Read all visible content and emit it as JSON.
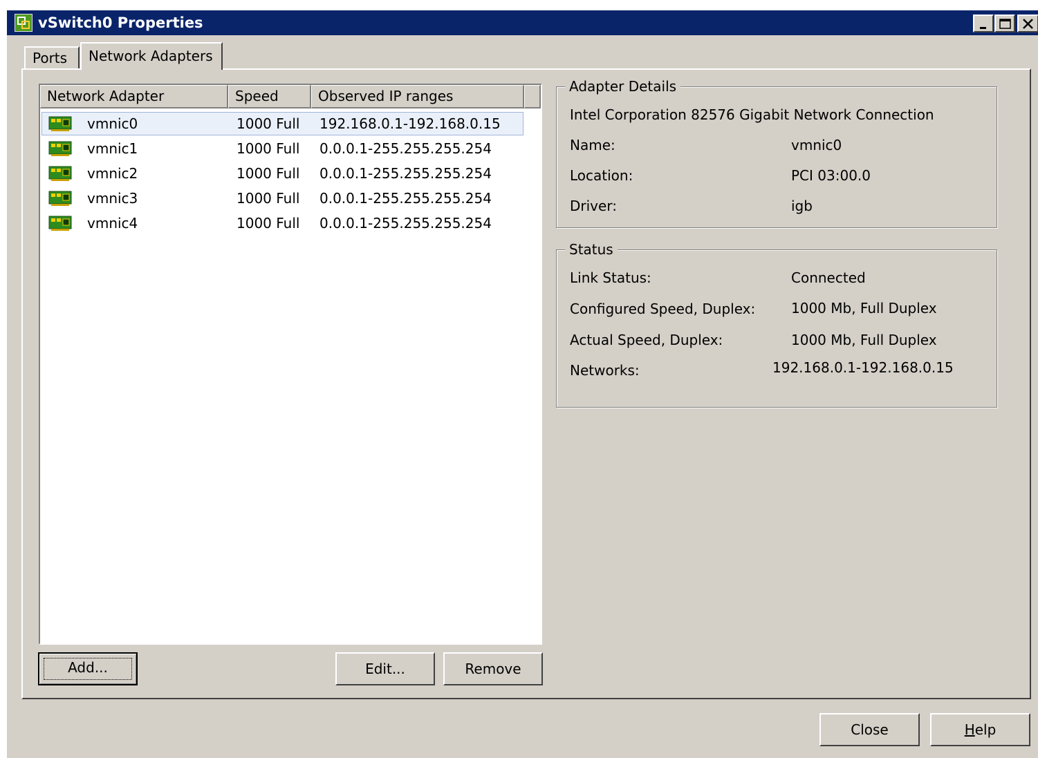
{
  "window": {
    "title": "vSwitch0 Properties",
    "icon": "vsphere-app-icon",
    "controls": [
      "minimize-icon",
      "maximize-icon",
      "close-icon"
    ]
  },
  "tabs": [
    {
      "label": "Ports",
      "active": false
    },
    {
      "label": "Network Adapters",
      "active": true
    }
  ],
  "adapter_list": {
    "columns": [
      "Network Adapter",
      "Speed",
      "Observed IP ranges"
    ],
    "rows": [
      {
        "name": "vmnic0",
        "speed": "1000 Full",
        "ip_range": "192.168.0.1-192.168.0.15",
        "selected": true
      },
      {
        "name": "vmnic1",
        "speed": "1000 Full",
        "ip_range": "0.0.0.1-255.255.255.254",
        "selected": false
      },
      {
        "name": "vmnic2",
        "speed": "1000 Full",
        "ip_range": "0.0.0.1-255.255.255.254",
        "selected": false
      },
      {
        "name": "vmnic3",
        "speed": "1000 Full",
        "ip_range": "0.0.0.1-255.255.255.254",
        "selected": false
      },
      {
        "name": "vmnic4",
        "speed": "1000 Full",
        "ip_range": "0.0.0.1-255.255.255.254",
        "selected": false
      }
    ],
    "row_icon": "network-card-icon"
  },
  "list_buttons": {
    "add": "Add...",
    "edit": "Edit...",
    "remove": "Remove"
  },
  "adapter_details": {
    "title": "Adapter Details",
    "description": "Intel Corporation 82576 Gigabit Network Connection",
    "name_label": "Name:",
    "name_value": "vmnic0",
    "location_label": "Location:",
    "location_value": "PCI 03:00.0",
    "driver_label": "Driver:",
    "driver_value": "igb"
  },
  "status": {
    "title": "Status",
    "link_status_label": "Link Status:",
    "link_status_value": "Connected",
    "configured_speed_label": "Configured Speed, Duplex:",
    "configured_speed_value": "1000 Mb, Full Duplex",
    "actual_speed_label": "Actual Speed, Duplex:",
    "actual_speed_value": "1000 Mb, Full Duplex",
    "networks_label": "Networks:",
    "networks_value": "192.168.0.1-192.168.0.15"
  },
  "dialog_buttons": {
    "close": "Close",
    "help_prefix": "",
    "help_mnemonic": "H",
    "help_rest": "elp"
  },
  "colors": {
    "titlebar": "#0a246a",
    "dialog_bg": "#d4d0c8",
    "selection_fill": "#eaf0fa",
    "nic_green": "#2e8b1e"
  }
}
